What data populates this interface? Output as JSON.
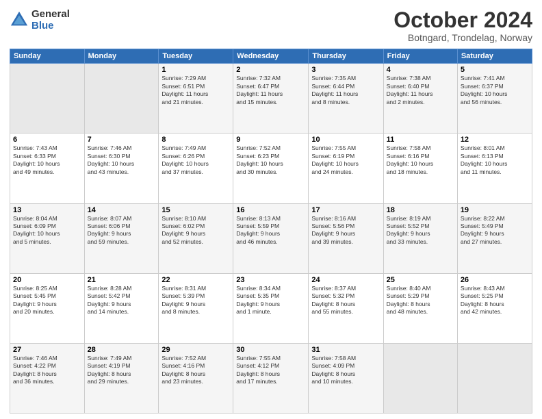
{
  "logo": {
    "line1": "General",
    "line2": "Blue"
  },
  "title": "October 2024",
  "subtitle": "Botngard, Trondelag, Norway",
  "days_of_week": [
    "Sunday",
    "Monday",
    "Tuesday",
    "Wednesday",
    "Thursday",
    "Friday",
    "Saturday"
  ],
  "weeks": [
    [
      {
        "day": "",
        "info": ""
      },
      {
        "day": "",
        "info": ""
      },
      {
        "day": "1",
        "info": "Sunrise: 7:29 AM\nSunset: 6:51 PM\nDaylight: 11 hours\nand 21 minutes."
      },
      {
        "day": "2",
        "info": "Sunrise: 7:32 AM\nSunset: 6:47 PM\nDaylight: 11 hours\nand 15 minutes."
      },
      {
        "day": "3",
        "info": "Sunrise: 7:35 AM\nSunset: 6:44 PM\nDaylight: 11 hours\nand 8 minutes."
      },
      {
        "day": "4",
        "info": "Sunrise: 7:38 AM\nSunset: 6:40 PM\nDaylight: 11 hours\nand 2 minutes."
      },
      {
        "day": "5",
        "info": "Sunrise: 7:41 AM\nSunset: 6:37 PM\nDaylight: 10 hours\nand 56 minutes."
      }
    ],
    [
      {
        "day": "6",
        "info": "Sunrise: 7:43 AM\nSunset: 6:33 PM\nDaylight: 10 hours\nand 49 minutes."
      },
      {
        "day": "7",
        "info": "Sunrise: 7:46 AM\nSunset: 6:30 PM\nDaylight: 10 hours\nand 43 minutes."
      },
      {
        "day": "8",
        "info": "Sunrise: 7:49 AM\nSunset: 6:26 PM\nDaylight: 10 hours\nand 37 minutes."
      },
      {
        "day": "9",
        "info": "Sunrise: 7:52 AM\nSunset: 6:23 PM\nDaylight: 10 hours\nand 30 minutes."
      },
      {
        "day": "10",
        "info": "Sunrise: 7:55 AM\nSunset: 6:19 PM\nDaylight: 10 hours\nand 24 minutes."
      },
      {
        "day": "11",
        "info": "Sunrise: 7:58 AM\nSunset: 6:16 PM\nDaylight: 10 hours\nand 18 minutes."
      },
      {
        "day": "12",
        "info": "Sunrise: 8:01 AM\nSunset: 6:13 PM\nDaylight: 10 hours\nand 11 minutes."
      }
    ],
    [
      {
        "day": "13",
        "info": "Sunrise: 8:04 AM\nSunset: 6:09 PM\nDaylight: 10 hours\nand 5 minutes."
      },
      {
        "day": "14",
        "info": "Sunrise: 8:07 AM\nSunset: 6:06 PM\nDaylight: 9 hours\nand 59 minutes."
      },
      {
        "day": "15",
        "info": "Sunrise: 8:10 AM\nSunset: 6:02 PM\nDaylight: 9 hours\nand 52 minutes."
      },
      {
        "day": "16",
        "info": "Sunrise: 8:13 AM\nSunset: 5:59 PM\nDaylight: 9 hours\nand 46 minutes."
      },
      {
        "day": "17",
        "info": "Sunrise: 8:16 AM\nSunset: 5:56 PM\nDaylight: 9 hours\nand 39 minutes."
      },
      {
        "day": "18",
        "info": "Sunrise: 8:19 AM\nSunset: 5:52 PM\nDaylight: 9 hours\nand 33 minutes."
      },
      {
        "day": "19",
        "info": "Sunrise: 8:22 AM\nSunset: 5:49 PM\nDaylight: 9 hours\nand 27 minutes."
      }
    ],
    [
      {
        "day": "20",
        "info": "Sunrise: 8:25 AM\nSunset: 5:45 PM\nDaylight: 9 hours\nand 20 minutes."
      },
      {
        "day": "21",
        "info": "Sunrise: 8:28 AM\nSunset: 5:42 PM\nDaylight: 9 hours\nand 14 minutes."
      },
      {
        "day": "22",
        "info": "Sunrise: 8:31 AM\nSunset: 5:39 PM\nDaylight: 9 hours\nand 8 minutes."
      },
      {
        "day": "23",
        "info": "Sunrise: 8:34 AM\nSunset: 5:35 PM\nDaylight: 9 hours\nand 1 minute."
      },
      {
        "day": "24",
        "info": "Sunrise: 8:37 AM\nSunset: 5:32 PM\nDaylight: 8 hours\nand 55 minutes."
      },
      {
        "day": "25",
        "info": "Sunrise: 8:40 AM\nSunset: 5:29 PM\nDaylight: 8 hours\nand 48 minutes."
      },
      {
        "day": "26",
        "info": "Sunrise: 8:43 AM\nSunset: 5:25 PM\nDaylight: 8 hours\nand 42 minutes."
      }
    ],
    [
      {
        "day": "27",
        "info": "Sunrise: 7:46 AM\nSunset: 4:22 PM\nDaylight: 8 hours\nand 36 minutes."
      },
      {
        "day": "28",
        "info": "Sunrise: 7:49 AM\nSunset: 4:19 PM\nDaylight: 8 hours\nand 29 minutes."
      },
      {
        "day": "29",
        "info": "Sunrise: 7:52 AM\nSunset: 4:16 PM\nDaylight: 8 hours\nand 23 minutes."
      },
      {
        "day": "30",
        "info": "Sunrise: 7:55 AM\nSunset: 4:12 PM\nDaylight: 8 hours\nand 17 minutes."
      },
      {
        "day": "31",
        "info": "Sunrise: 7:58 AM\nSunset: 4:09 PM\nDaylight: 8 hours\nand 10 minutes."
      },
      {
        "day": "",
        "info": ""
      },
      {
        "day": "",
        "info": ""
      }
    ]
  ]
}
